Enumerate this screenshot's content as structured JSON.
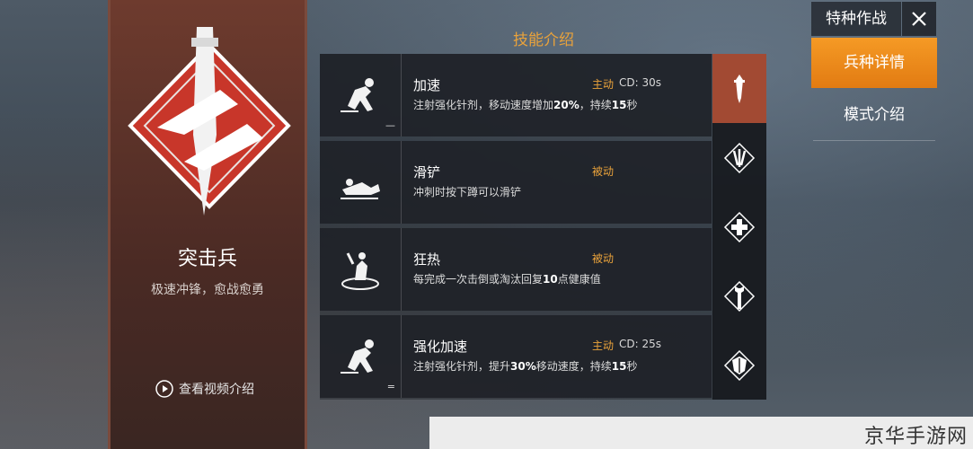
{
  "hero": {
    "class_name": "突击兵",
    "slogan": "极速冲锋，愈战愈勇",
    "video_label": "查看视频介绍"
  },
  "section_title": "技能介绍",
  "skills": [
    {
      "name": "加速",
      "type": "主动",
      "cd": "CD: 30s",
      "desc_pre": "注射强化针剂，移动速度增加",
      "desc_bold": "20%",
      "desc_mid": "，持续",
      "desc_bold2": "15",
      "desc_post": "秒",
      "tier": "—",
      "icon": "sprinting-soldier-icon"
    },
    {
      "name": "滑铲",
      "type": "被动",
      "cd": "",
      "desc_pre": "冲刺时按下蹲可以滑铲",
      "desc_bold": "",
      "desc_mid": "",
      "desc_bold2": "",
      "desc_post": "",
      "tier": "",
      "icon": "slide-soldier-icon"
    },
    {
      "name": "狂热",
      "type": "被动",
      "cd": "",
      "desc_pre": "每完成一次击倒或淘汰回复",
      "desc_bold": "10",
      "desc_mid": "点健康值",
      "desc_bold2": "",
      "desc_post": "",
      "tier": "",
      "icon": "frenzy-soldier-icon"
    },
    {
      "name": "强化加速",
      "type": "主动",
      "cd": "CD: 25s",
      "desc_pre": "注射强化针剂，提升",
      "desc_bold": "30%",
      "desc_mid": "移动速度，持续",
      "desc_bold2": "15",
      "desc_post": "秒",
      "tier": "=",
      "icon": "sprinting-soldier-icon"
    }
  ],
  "switcher": [
    {
      "icon": "dagger-icon",
      "active": true
    },
    {
      "icon": "claw-icon",
      "active": false
    },
    {
      "icon": "medic-cross-icon",
      "active": false
    },
    {
      "icon": "wrench-icon",
      "active": false
    },
    {
      "icon": "shield-icon",
      "active": false
    }
  ],
  "right_menu": {
    "title": "特种作战",
    "tab_active": "兵种详情",
    "tab_other": "模式介绍"
  },
  "watermark": "京华手游网",
  "colors": {
    "accent": "#e9a23b",
    "active_tab": "#f08c1c",
    "hero_red": "#a24a33"
  }
}
